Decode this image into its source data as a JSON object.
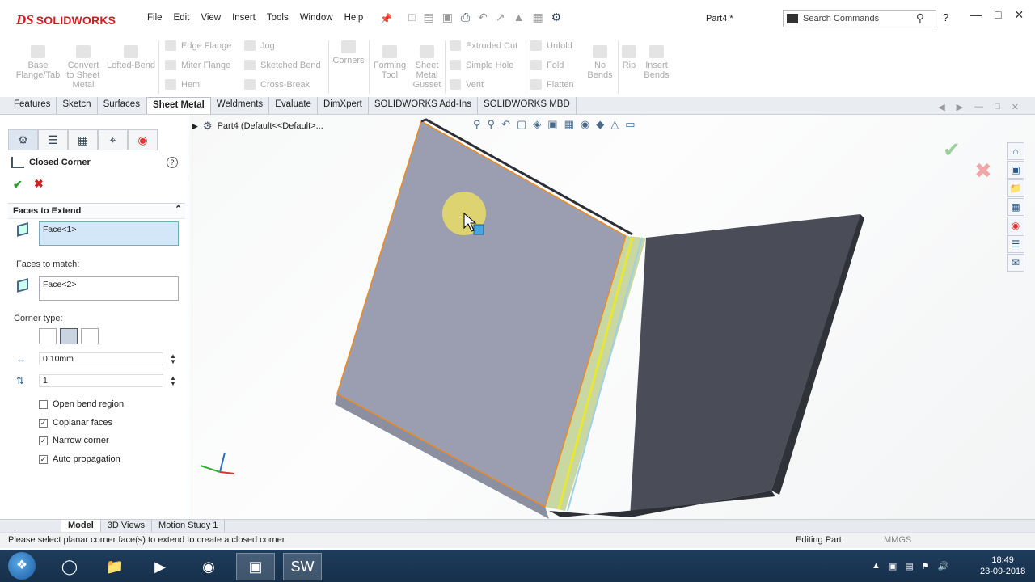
{
  "app": {
    "logo_prefix": "DS",
    "logo_text": "SOLIDWORKS",
    "doc_title": "Part4 *"
  },
  "menu": [
    "File",
    "Edit",
    "View",
    "Insert",
    "Tools",
    "Window",
    "Help"
  ],
  "search": {
    "placeholder": "Search Commands"
  },
  "ribbon": {
    "big": [
      {
        "label": "Base Flange/Tab"
      },
      {
        "label": "Convert to Sheet Metal"
      },
      {
        "label": "Lofted-Bend"
      },
      {
        "label": "Corners"
      },
      {
        "label": "Forming Tool"
      },
      {
        "label": "Sheet Metal Gusset"
      },
      {
        "label": "No Bends"
      },
      {
        "label": "Rip"
      },
      {
        "label": "Insert Bends"
      }
    ],
    "small": [
      "Edge Flange",
      "Miter Flange",
      "Hem",
      "Jog",
      "Sketched Bend",
      "Cross-Break",
      "Extruded Cut",
      "Simple Hole",
      "Vent",
      "Unfold",
      "Fold",
      "Flatten"
    ]
  },
  "tabs": [
    "Features",
    "Sketch",
    "Surfaces",
    "Sheet Metal",
    "Weldments",
    "Evaluate",
    "DimXpert",
    "SOLIDWORKS Add-Ins",
    "SOLIDWORKS MBD"
  ],
  "active_tab": "Sheet Metal",
  "pm": {
    "title": "Closed Corner",
    "group_label": "Faces to Extend",
    "face_extend": "Face<1>",
    "faces_match_label": "Faces to match:",
    "face_match": "Face<2>",
    "corner_type_label": "Corner type:",
    "gap": "0.10mm",
    "overlap": "1",
    "options": [
      {
        "label": "Open bend region",
        "checked": false
      },
      {
        "label": "Coplanar faces",
        "checked": true
      },
      {
        "label": "Narrow corner",
        "checked": true
      },
      {
        "label": "Auto propagation",
        "checked": true
      }
    ]
  },
  "tree": {
    "label": "Part4  (Default<<Default>..."
  },
  "bottom_tabs": [
    "Model",
    "3D Views",
    "Motion Study 1"
  ],
  "status": {
    "message": "Please select planar corner face(s) to extend to create a closed corner",
    "mode": "Editing Part",
    "units": "MMGS"
  },
  "clock": {
    "time": "18:49",
    "date": "23-09-2018"
  },
  "colors": {
    "accent": "#d71920",
    "edge_highlight": "#f08a1c",
    "face_select": "#e8e832"
  }
}
